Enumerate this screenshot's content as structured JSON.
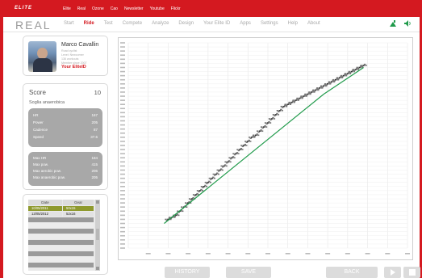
{
  "brand": {
    "logo": "ELITE"
  },
  "top_links": [
    "Elite",
    "Real",
    "Ozone",
    "Cao",
    "Newsletter",
    "Youtube",
    "Flickr"
  ],
  "app_logo": "REAL",
  "nav": {
    "items": [
      "Start",
      "Ride",
      "Test",
      "Compete",
      "Analyze",
      "Design",
      "Your Elite ID",
      "Apps",
      "Settings",
      "Help",
      "About"
    ],
    "active": "Ride"
  },
  "icons": {
    "status": "signal-icon",
    "sound": "speaker-icon"
  },
  "colors": {
    "accent": "#d41920",
    "selected_row": "#8f9a2e",
    "trend_line": "#1f9a4a"
  },
  "user": {
    "name": "Marco Cavallin",
    "meta": [
      "Road cyclist",
      "Level: Newcomer",
      "136 workouts",
      "Member since 2007"
    ],
    "elite_id_label": "Your EliteID"
  },
  "score": {
    "label": "Score",
    "value": "10",
    "subtitle": "Soglia anaerobica",
    "stats": [
      {
        "label": "HR",
        "value": "167"
      },
      {
        "label": "Power",
        "value": "205"
      },
      {
        "label": "Cadence",
        "value": "87"
      },
      {
        "label": "Speed",
        "value": "37.6"
      }
    ],
    "max_stats": [
      {
        "label": "Max HR",
        "value": "184"
      },
      {
        "label": "Max pow.",
        "value": "415"
      },
      {
        "label": "Max aerobic pow.",
        "value": "206"
      },
      {
        "label": "Max anaerobic pow.",
        "value": "205"
      }
    ]
  },
  "history_table": {
    "columns": [
      "Date",
      "Gear"
    ],
    "rows": [
      {
        "date": "10/05/2011",
        "gear": "50x15"
      },
      {
        "date": "13/05/2012",
        "gear": "52x16"
      }
    ],
    "selected_index": 0
  },
  "chart_data": {
    "type": "scatter",
    "series": [
      {
        "x": [
          20,
          22,
          24,
          26,
          28,
          30,
          32,
          34,
          36,
          38,
          40,
          42,
          44,
          46,
          48,
          50,
          52,
          54,
          56,
          58,
          60,
          62,
          64,
          66,
          68,
          70,
          72,
          74,
          76,
          78,
          80,
          82,
          84,
          86,
          88,
          90,
          92,
          94,
          96,
          98,
          100,
          102,
          104,
          106,
          108,
          110,
          112,
          114,
          116,
          118
        ],
        "y": [
          14,
          15,
          16,
          18,
          20,
          22,
          24,
          26,
          28,
          30,
          32,
          34,
          36,
          38,
          40,
          42,
          44,
          46,
          48,
          50,
          52,
          54,
          55,
          57,
          59,
          61,
          63,
          65,
          67,
          69,
          70,
          71,
          72,
          73,
          74,
          75,
          76,
          77,
          78,
          79,
          80,
          81,
          82,
          83,
          84,
          85,
          86,
          87,
          88,
          89
        ]
      }
    ],
    "trend": {
      "x": [
        18,
        98,
        118
      ],
      "y": [
        12,
        75,
        88
      ]
    }
  },
  "buttons": {
    "history": "HISTORY",
    "save": "SAVE",
    "back": "BACK"
  }
}
